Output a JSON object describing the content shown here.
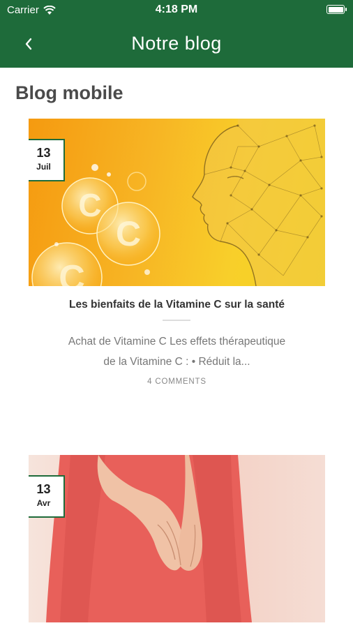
{
  "status_bar": {
    "carrier": "Carrier",
    "time": "4:18 PM"
  },
  "nav": {
    "title": "Notre blog"
  },
  "section": {
    "title": "Blog mobile"
  },
  "colors": {
    "brand_green": "#1e6b3a",
    "accent_orange": "#f7b524"
  },
  "posts": [
    {
      "day": "13",
      "month": "Juil",
      "title": "Les bienfaits de la Vitamine C sur la santé",
      "excerpt_line1": "Achat de Vitamine C Les effets thérapeutique",
      "excerpt_line2": "de la Vitamine C : • Réduit la...",
      "comments": "4 COMMENTS"
    },
    {
      "day": "13",
      "month": "Avr"
    }
  ]
}
